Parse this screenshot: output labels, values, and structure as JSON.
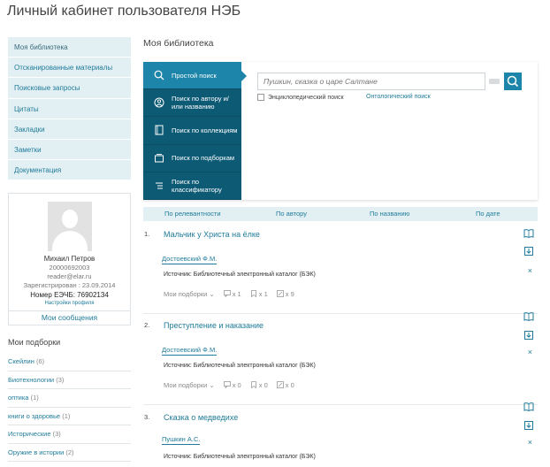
{
  "page": {
    "title": "Личный кабинет пользователя НЭБ"
  },
  "sidebar": {
    "items": [
      {
        "label": "Моя библиотека"
      },
      {
        "label": "Отсканированные материалы"
      },
      {
        "label": "Поисковые запросы"
      },
      {
        "label": "Цитаты"
      },
      {
        "label": "Закладки"
      },
      {
        "label": "Заметки"
      },
      {
        "label": "Документация"
      }
    ]
  },
  "profile": {
    "name": "Михаил Петров",
    "id": "20000692003",
    "email": "reader@elar.ru",
    "registered": "Зарегистрирован : 23.09.2014",
    "card": "Номер ЕЭЧБ: 76902134",
    "settings_label": "Настройки профиля",
    "messages_label": "Мои сообщения"
  },
  "selections": {
    "title": "Мои подборки",
    "items": [
      {
        "label": "Скейлин",
        "count": "(6)"
      },
      {
        "label": "Биотехнологии",
        "count": "(3)"
      },
      {
        "label": "оптика",
        "count": "(1)"
      },
      {
        "label": "книги о здоровье",
        "count": "(1)"
      },
      {
        "label": "Исторические",
        "count": "(3)"
      },
      {
        "label": "Оружие в истории",
        "count": "(2)"
      }
    ]
  },
  "main": {
    "title": "Моя библиотека"
  },
  "search": {
    "tabs": [
      {
        "label": "Простой поиск",
        "icon": "search-icon"
      },
      {
        "label": "Поиск по автору и/или названию",
        "icon": "author-icon"
      },
      {
        "label": "Поиск по коллекциям",
        "icon": "collection-icon"
      },
      {
        "label": "Поиск по подборкам",
        "icon": "selection-icon"
      },
      {
        "label": "Поиск по классификатору",
        "icon": "classifier-icon"
      }
    ],
    "placeholder": "Пушкин, сказка о царе Салтане",
    "encyclopedic_label": "Энциклопедический поиск",
    "ontology_label": "Онтологический поиск"
  },
  "sort": {
    "relevance": "По релевантности",
    "author": "По автору",
    "name": "По названию",
    "date": "По дате"
  },
  "results": [
    {
      "num": "1.",
      "title": "Мальчик у Христа на ёлке",
      "author": "Достоевский Ф.М.",
      "source": "Источник: Библиотечный электронный каталог (БЭК)",
      "my_selections": "Мои подборки",
      "quotes": "x 1",
      "bookmarks": "x 1",
      "notes": "x 9"
    },
    {
      "num": "2.",
      "title": "Преступление и наказание",
      "author": "Достоевский Ф.М.",
      "source": "Источник: Библиотечный электронный каталог (БЭК)",
      "my_selections": "Мои подборки",
      "quotes": "x 0",
      "bookmarks": "x 0",
      "notes": "x 0"
    },
    {
      "num": "3.",
      "title": "Сказка о медведихе",
      "author": "Пушкин А.С.",
      "source": "Источник: Библиотечный электронный каталог (БЭК)",
      "my_selections": "",
      "quotes": "",
      "bookmarks": "",
      "notes": ""
    }
  ],
  "colors": {
    "accent": "#1f7b9a",
    "tab_bg": "#0d5a75",
    "tab_active": "#1d85a9",
    "sidebar_bg": "#e3f0f3"
  }
}
